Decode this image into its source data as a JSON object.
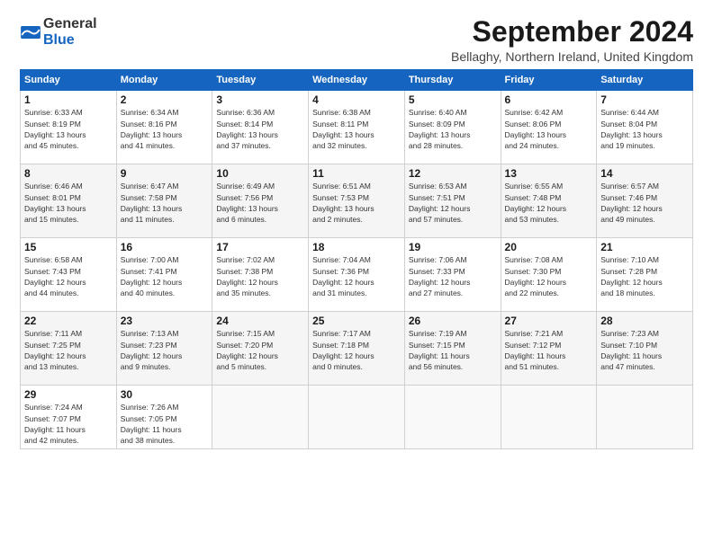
{
  "header": {
    "logo_general": "General",
    "logo_blue": "Blue",
    "month_title": "September 2024",
    "location": "Bellaghy, Northern Ireland, United Kingdom"
  },
  "weekdays": [
    "Sunday",
    "Monday",
    "Tuesday",
    "Wednesday",
    "Thursday",
    "Friday",
    "Saturday"
  ],
  "weeks": [
    [
      {
        "day": "1",
        "info": "Sunrise: 6:33 AM\nSunset: 8:19 PM\nDaylight: 13 hours\nand 45 minutes."
      },
      {
        "day": "2",
        "info": "Sunrise: 6:34 AM\nSunset: 8:16 PM\nDaylight: 13 hours\nand 41 minutes."
      },
      {
        "day": "3",
        "info": "Sunrise: 6:36 AM\nSunset: 8:14 PM\nDaylight: 13 hours\nand 37 minutes."
      },
      {
        "day": "4",
        "info": "Sunrise: 6:38 AM\nSunset: 8:11 PM\nDaylight: 13 hours\nand 32 minutes."
      },
      {
        "day": "5",
        "info": "Sunrise: 6:40 AM\nSunset: 8:09 PM\nDaylight: 13 hours\nand 28 minutes."
      },
      {
        "day": "6",
        "info": "Sunrise: 6:42 AM\nSunset: 8:06 PM\nDaylight: 13 hours\nand 24 minutes."
      },
      {
        "day": "7",
        "info": "Sunrise: 6:44 AM\nSunset: 8:04 PM\nDaylight: 13 hours\nand 19 minutes."
      }
    ],
    [
      {
        "day": "8",
        "info": "Sunrise: 6:46 AM\nSunset: 8:01 PM\nDaylight: 13 hours\nand 15 minutes."
      },
      {
        "day": "9",
        "info": "Sunrise: 6:47 AM\nSunset: 7:58 PM\nDaylight: 13 hours\nand 11 minutes."
      },
      {
        "day": "10",
        "info": "Sunrise: 6:49 AM\nSunset: 7:56 PM\nDaylight: 13 hours\nand 6 minutes."
      },
      {
        "day": "11",
        "info": "Sunrise: 6:51 AM\nSunset: 7:53 PM\nDaylight: 13 hours\nand 2 minutes."
      },
      {
        "day": "12",
        "info": "Sunrise: 6:53 AM\nSunset: 7:51 PM\nDaylight: 12 hours\nand 57 minutes."
      },
      {
        "day": "13",
        "info": "Sunrise: 6:55 AM\nSunset: 7:48 PM\nDaylight: 12 hours\nand 53 minutes."
      },
      {
        "day": "14",
        "info": "Sunrise: 6:57 AM\nSunset: 7:46 PM\nDaylight: 12 hours\nand 49 minutes."
      }
    ],
    [
      {
        "day": "15",
        "info": "Sunrise: 6:58 AM\nSunset: 7:43 PM\nDaylight: 12 hours\nand 44 minutes."
      },
      {
        "day": "16",
        "info": "Sunrise: 7:00 AM\nSunset: 7:41 PM\nDaylight: 12 hours\nand 40 minutes."
      },
      {
        "day": "17",
        "info": "Sunrise: 7:02 AM\nSunset: 7:38 PM\nDaylight: 12 hours\nand 35 minutes."
      },
      {
        "day": "18",
        "info": "Sunrise: 7:04 AM\nSunset: 7:36 PM\nDaylight: 12 hours\nand 31 minutes."
      },
      {
        "day": "19",
        "info": "Sunrise: 7:06 AM\nSunset: 7:33 PM\nDaylight: 12 hours\nand 27 minutes."
      },
      {
        "day": "20",
        "info": "Sunrise: 7:08 AM\nSunset: 7:30 PM\nDaylight: 12 hours\nand 22 minutes."
      },
      {
        "day": "21",
        "info": "Sunrise: 7:10 AM\nSunset: 7:28 PM\nDaylight: 12 hours\nand 18 minutes."
      }
    ],
    [
      {
        "day": "22",
        "info": "Sunrise: 7:11 AM\nSunset: 7:25 PM\nDaylight: 12 hours\nand 13 minutes."
      },
      {
        "day": "23",
        "info": "Sunrise: 7:13 AM\nSunset: 7:23 PM\nDaylight: 12 hours\nand 9 minutes."
      },
      {
        "day": "24",
        "info": "Sunrise: 7:15 AM\nSunset: 7:20 PM\nDaylight: 12 hours\nand 5 minutes."
      },
      {
        "day": "25",
        "info": "Sunrise: 7:17 AM\nSunset: 7:18 PM\nDaylight: 12 hours\nand 0 minutes."
      },
      {
        "day": "26",
        "info": "Sunrise: 7:19 AM\nSunset: 7:15 PM\nDaylight: 11 hours\nand 56 minutes."
      },
      {
        "day": "27",
        "info": "Sunrise: 7:21 AM\nSunset: 7:12 PM\nDaylight: 11 hours\nand 51 minutes."
      },
      {
        "day": "28",
        "info": "Sunrise: 7:23 AM\nSunset: 7:10 PM\nDaylight: 11 hours\nand 47 minutes."
      }
    ],
    [
      {
        "day": "29",
        "info": "Sunrise: 7:24 AM\nSunset: 7:07 PM\nDaylight: 11 hours\nand 42 minutes."
      },
      {
        "day": "30",
        "info": "Sunrise: 7:26 AM\nSunset: 7:05 PM\nDaylight: 11 hours\nand 38 minutes."
      },
      {
        "day": "",
        "info": ""
      },
      {
        "day": "",
        "info": ""
      },
      {
        "day": "",
        "info": ""
      },
      {
        "day": "",
        "info": ""
      },
      {
        "day": "",
        "info": ""
      }
    ]
  ]
}
